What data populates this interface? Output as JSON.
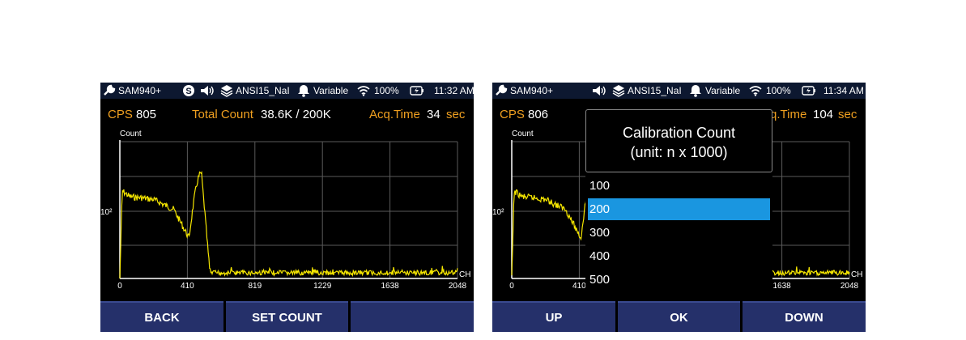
{
  "screens": [
    {
      "status": {
        "device": "SAM940+",
        "library": "ANSI15_NaI",
        "mode": "Variable",
        "battery": "100%",
        "time": "11:32 AM"
      },
      "info": {
        "cps_label": "CPS",
        "cps_value": "805",
        "total_label": "Total Count",
        "total_value": "38.6K / 200K",
        "acq_label": "Acq.Time",
        "acq_value": "34",
        "acq_unit": "sec"
      },
      "softkeys": [
        "BACK",
        "SET COUNT",
        ""
      ]
    },
    {
      "status": {
        "device": "SAM940+",
        "library": "ANSI15_NaI",
        "mode": "Variable",
        "battery": "100%",
        "time": "11:34 AM"
      },
      "info": {
        "cps_label": "CPS",
        "cps_value": "806",
        "acq_label": "q.Time",
        "acq_value": "104",
        "acq_unit": "sec"
      },
      "dialog": {
        "title_line1": "Calibration Count",
        "title_line2": "(unit: n x 1000)",
        "options": [
          "100",
          "200",
          "300",
          "400",
          "500"
        ],
        "selected": "200"
      },
      "softkeys": [
        "UP",
        "OK",
        "DOWN"
      ],
      "x_ticks_visible": [
        "1638",
        "2048"
      ]
    }
  ],
  "chart_data": {
    "type": "line",
    "ylabel": "Count",
    "xlabel": "CH",
    "y_tick_label": "10²",
    "x_ticks": [
      "0",
      "410",
      "819",
      "1229",
      "1638",
      "2048"
    ],
    "xlim": [
      0,
      2048
    ],
    "series": [
      {
        "values": "gamma spectrum (NaI) — high continuum near ch 0-200, dip ~400, photopeak ~495, flat low background beyond ch 540"
      }
    ]
  },
  "colors": {
    "accent": "#f0a020",
    "spectrum": "#f5e600",
    "softkey": "#25306a",
    "selected": "#1a96e0"
  }
}
